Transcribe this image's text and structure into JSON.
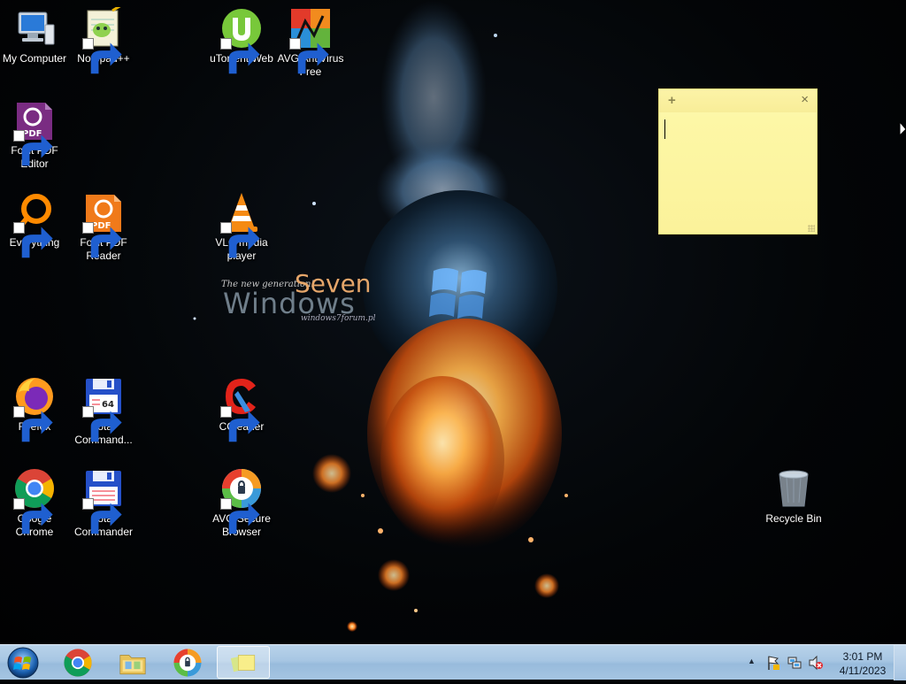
{
  "desktop": {
    "icons": [
      {
        "label": "My Computer",
        "icon": "computer-icon"
      },
      {
        "label": "Notepad++",
        "icon": "notepadpp-icon"
      },
      {
        "label": "uTorrent Web",
        "icon": "utorrent-icon"
      },
      {
        "label": "AVG AntiVirus Free",
        "icon": "avg-antivirus-icon"
      },
      {
        "label": "Foxit PDF Editor",
        "icon": "foxit-pdf-editor-icon"
      },
      {
        "label": "Everything",
        "icon": "everything-search-icon"
      },
      {
        "label": "Foxit PDF Reader",
        "icon": "foxit-pdf-reader-icon"
      },
      {
        "label": "VLC media player",
        "icon": "vlc-cone-icon"
      },
      {
        "label": "Firefox",
        "icon": "firefox-icon"
      },
      {
        "label": "Total Command...",
        "icon": "total-commander-64-icon"
      },
      {
        "label": "CCleaner",
        "icon": "ccleaner-icon"
      },
      {
        "label": "Google Chrome",
        "icon": "chrome-icon"
      },
      {
        "label": "Total Commander",
        "icon": "total-commander-icon"
      },
      {
        "label": "AVG Secure Browser",
        "icon": "avg-secure-browser-icon"
      },
      {
        "label": "Recycle Bin",
        "icon": "recycle-bin-icon"
      }
    ]
  },
  "wallpaper": {
    "tagline": "The new generation!",
    "seven": "Seven",
    "windows": "Windows",
    "forum": "windows7forum.pl"
  },
  "sticky_note": {
    "add_symbol": "+",
    "close_symbol": "×",
    "text": ""
  },
  "taskbar": {
    "pinned": [
      {
        "name": "Google Chrome",
        "icon": "chrome-icon"
      },
      {
        "name": "Windows Explorer",
        "icon": "folder-icon"
      },
      {
        "name": "AVG Secure Browser",
        "icon": "avg-secure-browser-icon"
      },
      {
        "name": "Sticky Notes",
        "icon": "sticky-notes-icon",
        "active": true
      }
    ],
    "tray": {
      "show_hidden": "▲",
      "icons": [
        "action-center-flag-icon",
        "network-icon",
        "volume-muted-icon"
      ],
      "time": "3:01 PM",
      "date": "4/11/2023"
    }
  },
  "colors": {
    "taskbar": "#a7c6e3",
    "sticky": "#fdf7a6",
    "label_text": "#ffffff"
  }
}
